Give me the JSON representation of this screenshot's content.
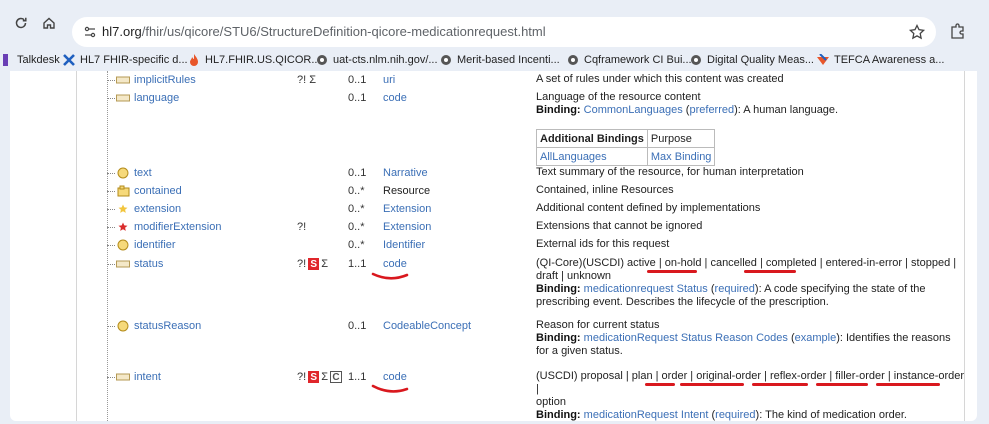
{
  "toolbar": {
    "url_host": "hl7.org",
    "url_path": "/fhir/us/qicore/STU6/StructureDefinition-qicore-medicationrequest.html"
  },
  "bookmarks": [
    {
      "label": "Talkdesk",
      "icon": "talkdesk-icon"
    },
    {
      "label": "HL7 FHIR-specific d...",
      "icon": "hl7-icon"
    },
    {
      "label": "HL7.FHIR.US.QICOR...",
      "icon": "fire-icon"
    },
    {
      "label": "uat-cts.nlm.nih.gov/...",
      "icon": "globe-icon"
    },
    {
      "label": "Merit-based Incenti...",
      "icon": "globe-icon"
    },
    {
      "label": "Cqframework CI Bui...",
      "icon": "globe-icon"
    },
    {
      "label": "Digital Quality Meas...",
      "icon": "globe-icon"
    },
    {
      "label": "TEFCA Awareness a...",
      "icon": "tefca-icon"
    }
  ],
  "rows": {
    "implicitRules": {
      "name": "implicitRules",
      "flags": "?! Σ",
      "card": "0..1",
      "type": "uri",
      "desc": "A set of rules under which this content was created"
    },
    "language": {
      "name": "language",
      "card": "0..1",
      "type": "code",
      "desc": "Language of the resource content",
      "binding_label": "Binding:",
      "binding_link": "CommonLanguages",
      "strength": "preferred",
      "binding_text": ": A human language."
    },
    "additional_bindings": {
      "h1": "Additional Bindings",
      "h2": "Purpose",
      "c1": "AllLanguages",
      "c2": "Max Binding"
    },
    "text": {
      "name": "text",
      "card": "0..1",
      "type": "Narrative",
      "desc": "Text summary of the resource, for human interpretation"
    },
    "contained": {
      "name": "contained",
      "card": "0..*",
      "type": "Resource",
      "desc": "Contained, inline Resources"
    },
    "extension": {
      "name": "extension",
      "card": "0..*",
      "type": "Extension",
      "desc": "Additional content defined by implementations"
    },
    "modifierExtension": {
      "name": "modifierExtension",
      "flags": "?!",
      "card": "0..*",
      "type": "Extension",
      "desc": "Extensions that cannot be ignored"
    },
    "identifier": {
      "name": "identifier",
      "card": "0..*",
      "type": "Identifier",
      "desc": "External ids for this request"
    },
    "status": {
      "name": "status",
      "flag1": "?!",
      "s": "S",
      "sigma": "Σ",
      "card": "1..1",
      "type": "code",
      "desc1": "(QI-Core)(USCDI) active |",
      "v_onhold": "on-hold",
      "desc2": "| cancelled |",
      "v_completed": "completed",
      "desc3": "| entered-in-error | stopped |",
      "desc4": "draft | unknown",
      "binding_label": "Binding:",
      "binding_link": "medicationrequest Status",
      "strength": "required",
      "binding_text": ": A code specifying the state of the prescribing event. Describes the lifecycle of the prescription."
    },
    "statusReason": {
      "name": "statusReason",
      "card": "0..1",
      "type": "CodeableConcept",
      "desc": "Reason for current status",
      "binding_label": "Binding:",
      "binding_link": "medicationRequest Status Reason Codes",
      "strength": "example",
      "binding_text": ": Identifies the reasons for a given status."
    },
    "intent": {
      "name": "intent",
      "flag1": "?!",
      "s": "S",
      "sigma": "Σ",
      "c": "C",
      "card": "1..1",
      "type": "code",
      "desc1": "(USCDI) proposal | plan |",
      "v_order": "order",
      "sep1": "|",
      "v_original": "original-order",
      "sep2": "|",
      "v_reflex": "reflex-order",
      "sep3": "|",
      "v_filler": "filler-order",
      "sep4": "|",
      "v_instance": "instance-order",
      "sep5": "|",
      "desc2": "option",
      "binding_label": "Binding:",
      "binding_link": "medicationRequest Intent",
      "strength": "required",
      "binding_text": ": The kind of medication order."
    }
  },
  "colors": {
    "link": "#3b6fb6",
    "mustSupport": "#e0262b",
    "annotation": "#d9181e"
  }
}
